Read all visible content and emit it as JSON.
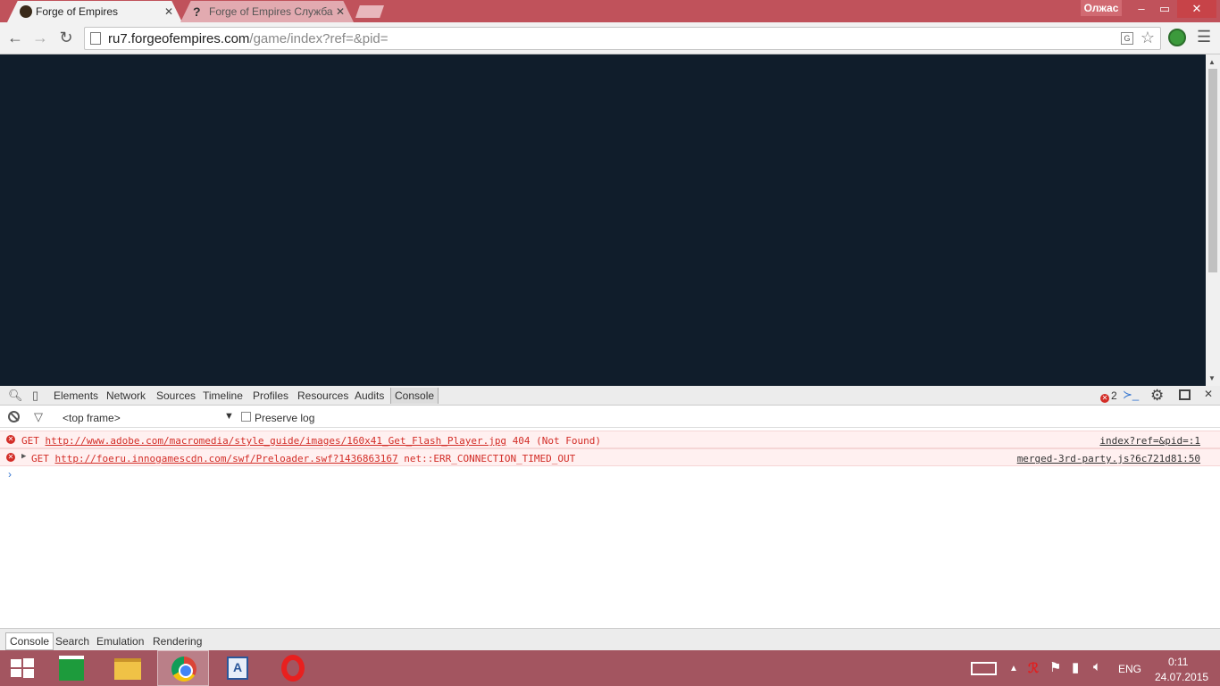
{
  "browser": {
    "tabs": [
      {
        "title": "Forge of Empires",
        "active": true,
        "favicon": "forge-of-empires-icon"
      },
      {
        "title": "Forge of Empires Служба",
        "active": false,
        "favicon": "question-icon"
      }
    ],
    "user": "Олжас",
    "window_controls": {
      "minimize": "–",
      "maximize": "▭",
      "close": "✕"
    },
    "url": {
      "host": "ru7.forgeofempires.com",
      "path": "/game/index?ref=&pid="
    },
    "page_background": "#101d2b"
  },
  "devtools": {
    "toolbar_tabs": [
      "Elements",
      "Network",
      "Sources",
      "Timeline",
      "Profiles",
      "Resources",
      "Audits",
      "Console"
    ],
    "active_tab": "Console",
    "error_count": "2",
    "frame": "<top frame>",
    "preserve_log_label": "Preserve log",
    "messages": [
      {
        "method": "GET",
        "url": "http://www.adobe.com/macromedia/style_guide/images/160x41_Get_Flash_Player.jpg",
        "status": "404 (Not Found)",
        "source": "index?ref=&pid=:1",
        "expandable": false
      },
      {
        "method": "GET",
        "url": "http://foeru.innogamescdn.com/swf/Preloader.swf?1436863167",
        "status": "net::ERR_CONNECTION_TIMED_OUT",
        "source": "merged-3rd-party.js?6c721d81:50",
        "expandable": true
      }
    ],
    "prompt": "›",
    "drawer_tabs": [
      "Console",
      "Search",
      "Emulation",
      "Rendering"
    ],
    "drawer_active": "Console",
    "error_color": "#d32d27"
  },
  "taskbar": {
    "items": [
      "start-icon",
      "store-icon",
      "explorer-icon",
      "chrome-icon",
      "document-icon",
      "opera-icon"
    ],
    "active_item": "chrome-icon",
    "language": "ENG",
    "time": "0:11",
    "date": "24.07.2015"
  }
}
